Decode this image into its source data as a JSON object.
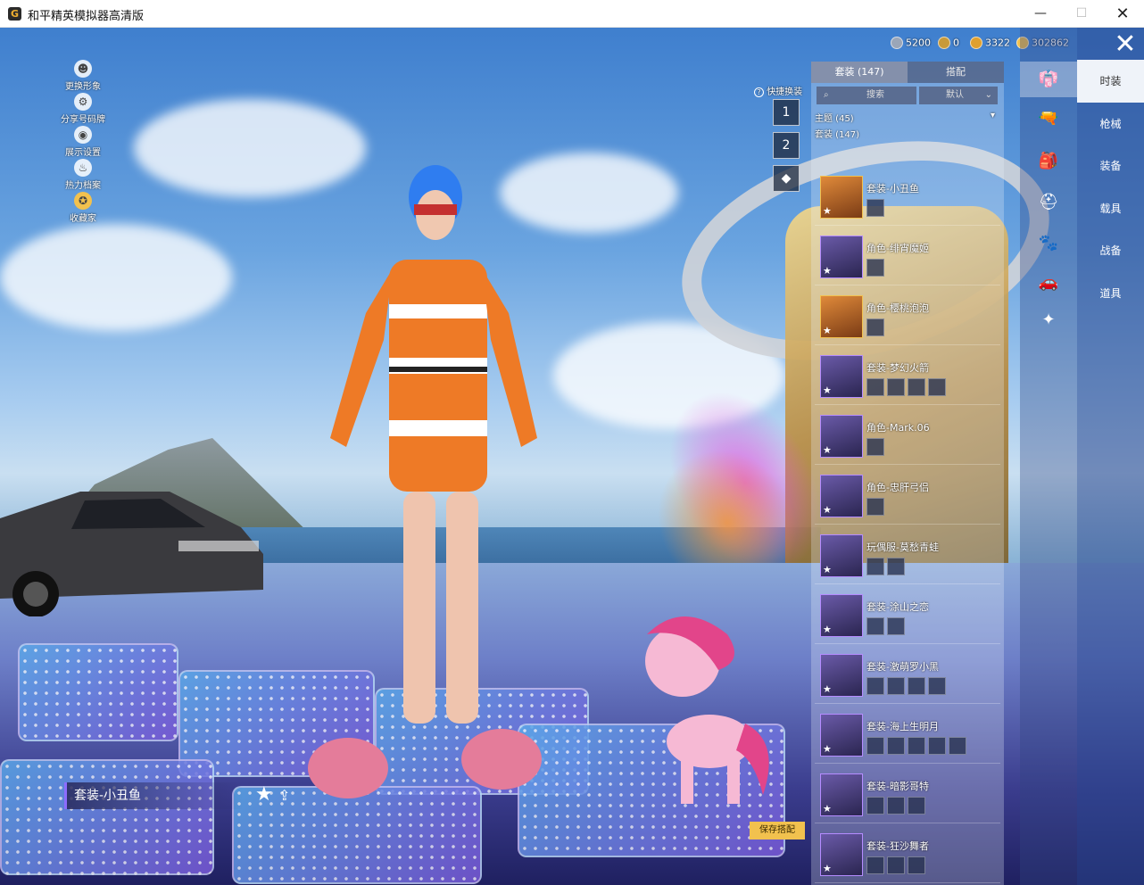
{
  "window": {
    "title": "和平精英模拟器高清版",
    "app_icon_letter": "G",
    "minimize": "—",
    "maximize": "☐",
    "close": "✕"
  },
  "left_menu": [
    {
      "label": "更换形象",
      "icon": "person-icon",
      "glyph": "☻"
    },
    {
      "label": "分享号码牌",
      "icon": "share-gear-icon",
      "glyph": "⚙"
    },
    {
      "label": "展示设置",
      "icon": "eye-icon",
      "glyph": "◉"
    },
    {
      "label": "热力档案",
      "icon": "flame-icon",
      "glyph": "♨"
    },
    {
      "label": "收藏家",
      "icon": "badge-icon",
      "glyph": "✪"
    }
  ],
  "quick_swap": {
    "label": "快捷换装",
    "help": "?",
    "buttons": [
      "1",
      "2",
      "◆"
    ]
  },
  "currency": [
    {
      "value": "5200",
      "color": "#9aa6b8"
    },
    {
      "value": "0",
      "color": "#c89a3a"
    },
    {
      "value": "3322",
      "color": "#e0a02e"
    },
    {
      "value": "302862",
      "color": "#f2c14e"
    }
  ],
  "close_label": "✕",
  "panel": {
    "tabs": [
      "套装 (147)",
      "搭配"
    ],
    "search_placeholder": "搜索",
    "sort": "默认",
    "theme_label": "主题 (45)",
    "set_label": "套装 (147)",
    "items": [
      {
        "name": "套装-小丑鱼",
        "parts": 1,
        "gold": true
      },
      {
        "name": "角色-绯宵魔姬",
        "parts": 1,
        "gold": false
      },
      {
        "name": "角色-樱桃泡泡",
        "parts": 1,
        "gold": true
      },
      {
        "name": "套装-梦幻火箭",
        "parts": 4,
        "gold": false
      },
      {
        "name": "角色-Mark.06",
        "parts": 1,
        "gold": false
      },
      {
        "name": "角色-忠肝弓侣",
        "parts": 1,
        "gold": false
      },
      {
        "name": "玩偶服-莫愁青蛙",
        "parts": 2,
        "gold": false
      },
      {
        "name": "套装-涂山之恋",
        "parts": 2,
        "gold": false
      },
      {
        "name": "套装-激萌罗小黑",
        "parts": 4,
        "gold": false
      },
      {
        "name": "套装-海上生明月",
        "parts": 5,
        "gold": false
      },
      {
        "name": "套装-暗影哥特",
        "parts": 3,
        "gold": false
      },
      {
        "name": "套装-狂沙舞者",
        "parts": 3,
        "gold": false
      }
    ]
  },
  "categories": [
    "outfit-icon",
    "gun-icon",
    "gear-icon",
    "helmet-icon",
    "pet-icon",
    "vehicle-icon",
    "emote-icon"
  ],
  "right_nav": [
    "时装",
    "枪械",
    "装备",
    "载具",
    "战备",
    "道具"
  ],
  "current_outfit": "套装-小丑鱼",
  "star_glyph": "★",
  "share_glyph": "⇪",
  "save_label": "保存搭配",
  "colors": {
    "accent": "#f2c14e",
    "purple": "#8c6cff"
  }
}
